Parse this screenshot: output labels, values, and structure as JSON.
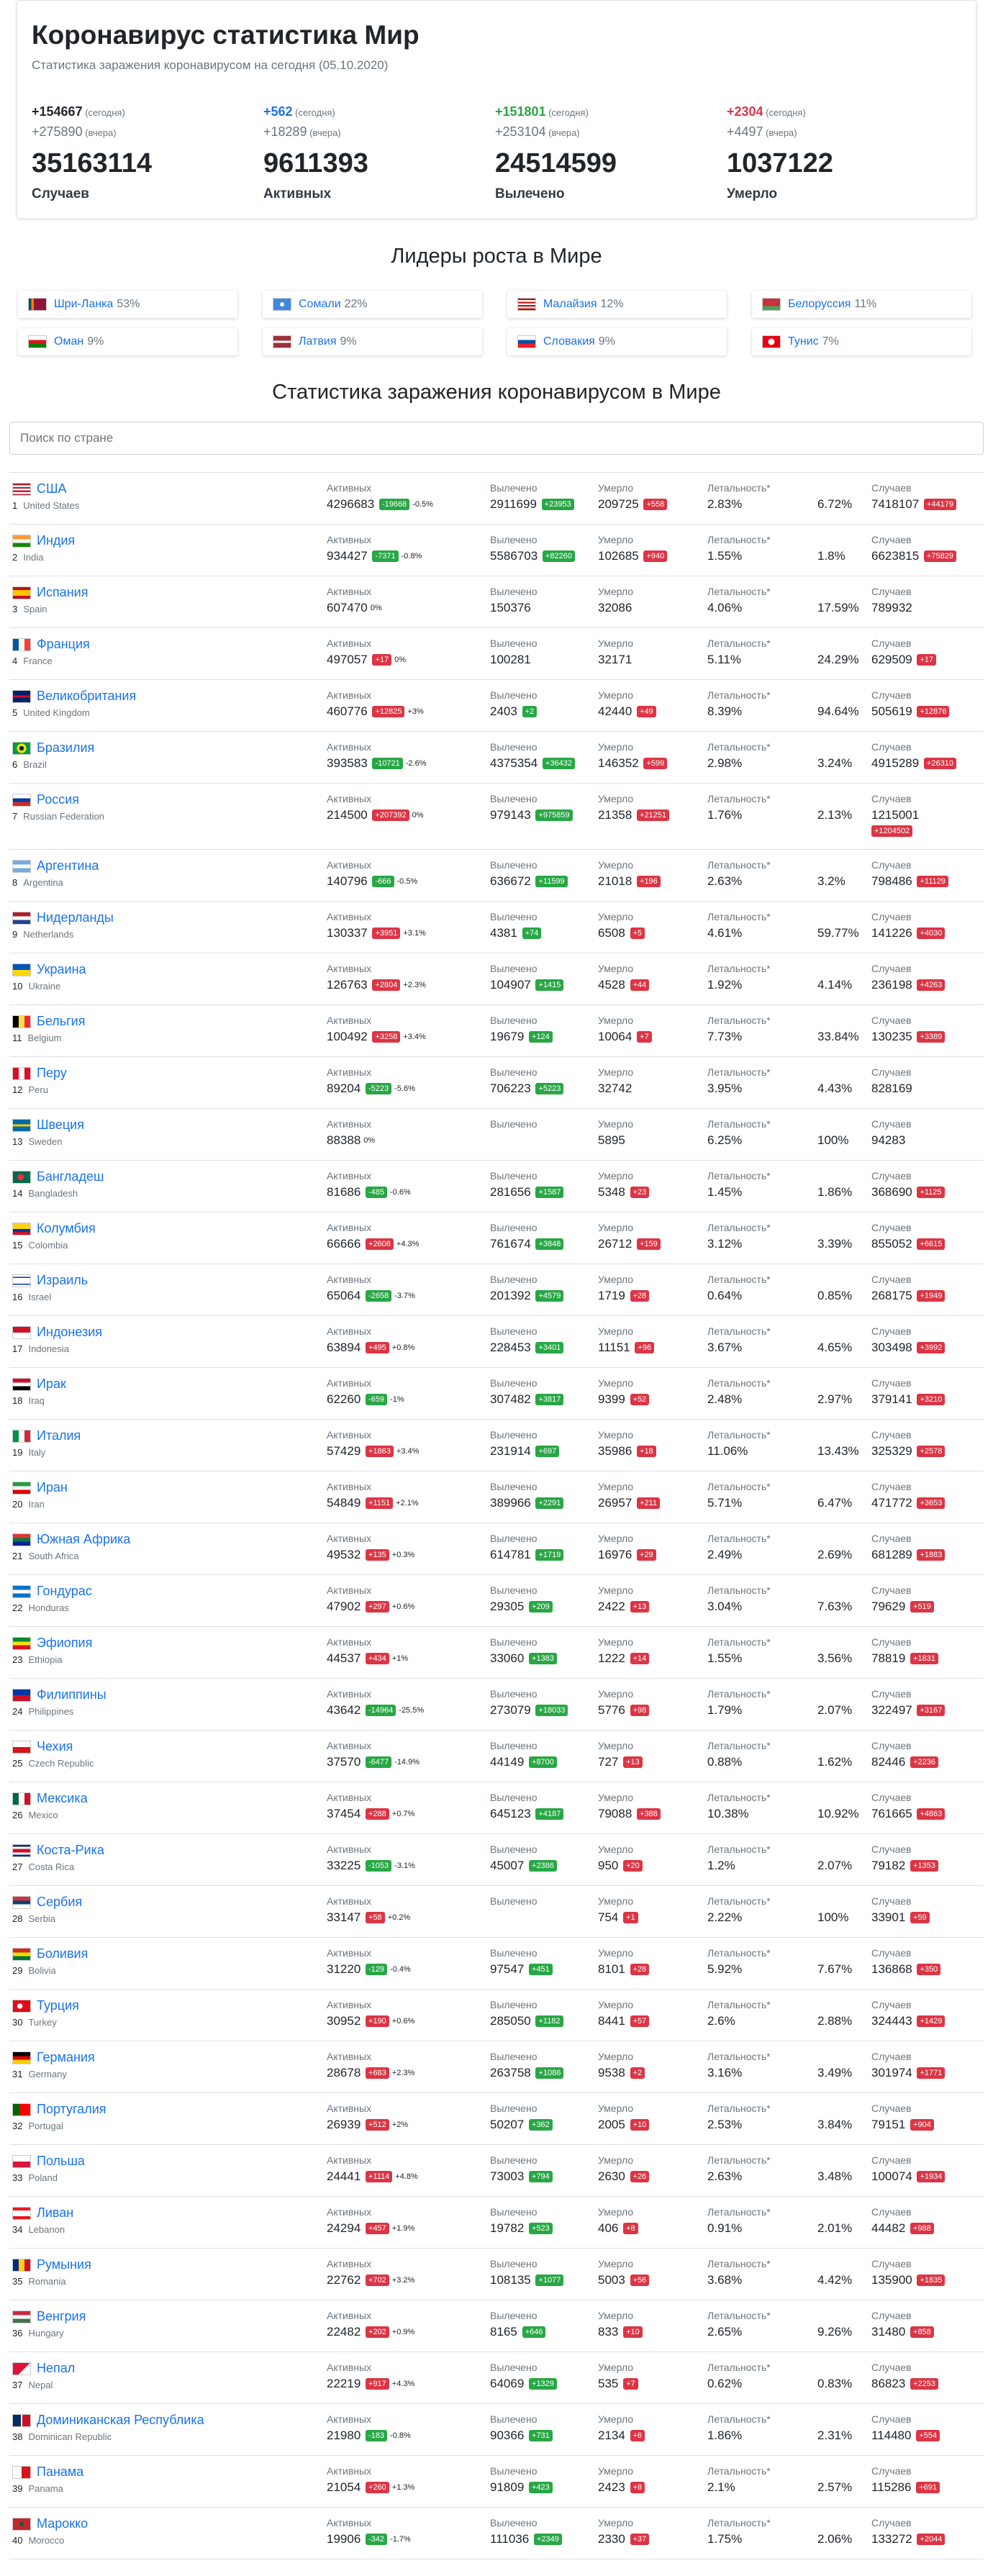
{
  "header": {
    "title": "Коронавирус статистика Мир",
    "subtitle": "Статистика заражения коронавирусом на сегодня (05.10.2020)"
  },
  "summary": [
    {
      "today": "+154667",
      "today_label": "(сегодня)",
      "yesterday": "+275890",
      "yesterday_label": "(вчера)",
      "total": "35163114",
      "name": "Случаев",
      "color": "dark"
    },
    {
      "today": "+562",
      "today_label": "(сегодня)",
      "yesterday": "+18289",
      "yesterday_label": "(вчера)",
      "total": "9611393",
      "name": "Активных",
      "color": "blue"
    },
    {
      "today": "+151801",
      "today_label": "(сегодня)",
      "yesterday": "+253104",
      "yesterday_label": "(вчера)",
      "total": "24514599",
      "name": "Вылечено",
      "color": "green"
    },
    {
      "today": "+2304",
      "today_label": "(сегодня)",
      "yesterday": "+4497",
      "yesterday_label": "(вчера)",
      "total": "1037122",
      "name": "Умерло",
      "color": "red"
    }
  ],
  "leaders": {
    "title": "Лидеры роста в Мире",
    "items": [
      {
        "name": "Шри-Ланка",
        "pct": "53%",
        "flag": "lk"
      },
      {
        "name": "Сомали",
        "pct": "22%",
        "flag": "so"
      },
      {
        "name": "Малайзия",
        "pct": "12%",
        "flag": "my"
      },
      {
        "name": "Белоруссия",
        "pct": "11%",
        "flag": "by"
      },
      {
        "name": "Оман",
        "pct": "9%",
        "flag": "om"
      },
      {
        "name": "Латвия",
        "pct": "9%",
        "flag": "lv"
      },
      {
        "name": "Словакия",
        "pct": "9%",
        "flag": "sk"
      },
      {
        "name": "Тунис",
        "pct": "7%",
        "flag": "tn"
      }
    ]
  },
  "stats": {
    "title": "Статистика заражения коронавирусом в Мире",
    "search_placeholder": "Поиск по стране",
    "labels": {
      "active": "Активных",
      "recovered": "Вылечено",
      "deaths": "Умерло",
      "lethality": "Летальность*",
      "cases": "Случаев"
    }
  },
  "countries": [
    {
      "rank": "1",
      "ru": "США",
      "en": "United States",
      "flag": "us",
      "active": "4296683",
      "active_delta": "-19668",
      "active_pct": "-0.5%",
      "rec": "2911699",
      "rec_delta": "+23953",
      "dead": "209725",
      "dead_delta": "+558",
      "let1": "2.83%",
      "let2": "6.72%",
      "cases": "7418107",
      "cases_delta": "+44179"
    },
    {
      "rank": "2",
      "ru": "Индия",
      "en": "India",
      "flag": "in",
      "active": "934427",
      "active_delta": "-7371",
      "active_pct": "-0.8%",
      "rec": "5586703",
      "rec_delta": "+82260",
      "dead": "102685",
      "dead_delta": "+940",
      "let1": "1.55%",
      "let2": "1.8%",
      "cases": "6623815",
      "cases_delta": "+75829"
    },
    {
      "rank": "3",
      "ru": "Испания",
      "en": "Spain",
      "flag": "es",
      "active": "607470",
      "active_delta": "",
      "active_pct": "0%",
      "rec": "150376",
      "rec_delta": "",
      "dead": "32086",
      "dead_delta": "",
      "let1": "4.06%",
      "let2": "17.59%",
      "cases": "789932",
      "cases_delta": ""
    },
    {
      "rank": "4",
      "ru": "Франция",
      "en": "France",
      "flag": "fr",
      "active": "497057",
      "active_delta": "+17",
      "active_pct": "0%",
      "rec": "100281",
      "rec_delta": "",
      "dead": "32171",
      "dead_delta": "",
      "let1": "5.11%",
      "let2": "24.29%",
      "cases": "629509",
      "cases_delta": "+17"
    },
    {
      "rank": "5",
      "ru": "Великобритания",
      "en": "United Kingdom",
      "flag": "gb",
      "active": "460776",
      "active_delta": "+12825",
      "active_pct": "+3%",
      "rec": "2403",
      "rec_delta": "+2",
      "dead": "42440",
      "dead_delta": "+49",
      "let1": "8.39%",
      "let2": "94.64%",
      "cases": "505619",
      "cases_delta": "+12876"
    },
    {
      "rank": "6",
      "ru": "Бразилия",
      "en": "Brazil",
      "flag": "br",
      "active": "393583",
      "active_delta": "-10721",
      "active_pct": "-2.6%",
      "rec": "4375354",
      "rec_delta": "+36432",
      "dead": "146352",
      "dead_delta": "+599",
      "let1": "2.98%",
      "let2": "3.24%",
      "cases": "4915289",
      "cases_delta": "+26310"
    },
    {
      "rank": "7",
      "ru": "Россия",
      "en": "Russian Federation",
      "flag": "ru",
      "active": "214500",
      "active_delta": "+207392",
      "active_pct": "0%",
      "rec": "979143",
      "rec_delta": "+975859",
      "dead": "21358",
      "dead_delta": "+21251",
      "let1": "1.76%",
      "let2": "2.13%",
      "cases": "1215001",
      "cases_delta": "+1204502",
      "tall": true
    },
    {
      "rank": "8",
      "ru": "Аргентина",
      "en": "Argentina",
      "flag": "ar",
      "active": "140796",
      "active_delta": "-666",
      "active_pct": "-0.5%",
      "rec": "636672",
      "rec_delta": "+11599",
      "dead": "21018",
      "dead_delta": "+196",
      "let1": "2.63%",
      "let2": "3.2%",
      "cases": "798486",
      "cases_delta": "+11129"
    },
    {
      "rank": "9",
      "ru": "Нидерланды",
      "en": "Netherlands",
      "flag": "nl",
      "active": "130337",
      "active_delta": "+3951",
      "active_pct": "+3.1%",
      "rec": "4381",
      "rec_delta": "+74",
      "dead": "6508",
      "dead_delta": "+5",
      "let1": "4.61%",
      "let2": "59.77%",
      "cases": "141226",
      "cases_delta": "+4030"
    },
    {
      "rank": "10",
      "ru": "Украина",
      "en": "Ukraine",
      "flag": "ua",
      "active": "126763",
      "active_delta": "+2804",
      "active_pct": "+2.3%",
      "rec": "104907",
      "rec_delta": "+1415",
      "dead": "4528",
      "dead_delta": "+44",
      "let1": "1.92%",
      "let2": "4.14%",
      "cases": "236198",
      "cases_delta": "+4263"
    },
    {
      "rank": "11",
      "ru": "Бельгия",
      "en": "Belgium",
      "flag": "be",
      "active": "100492",
      "active_delta": "+3258",
      "active_pct": "+3.4%",
      "rec": "19679",
      "rec_delta": "+124",
      "dead": "10064",
      "dead_delta": "+7",
      "let1": "7.73%",
      "let2": "33.84%",
      "cases": "130235",
      "cases_delta": "+3389"
    },
    {
      "rank": "12",
      "ru": "Перу",
      "en": "Peru",
      "flag": "pe",
      "active": "89204",
      "active_delta": "-5223",
      "active_pct": "-5.6%",
      "rec": "706223",
      "rec_delta": "+5223",
      "dead": "32742",
      "dead_delta": "",
      "let1": "3.95%",
      "let2": "4.43%",
      "cases": "828169",
      "cases_delta": ""
    },
    {
      "rank": "13",
      "ru": "Швеция",
      "en": "Sweden",
      "flag": "se",
      "active": "88388",
      "active_delta": "",
      "active_pct": "0%",
      "rec": "",
      "rec_delta": "",
      "dead": "5895",
      "dead_delta": "",
      "let1": "6.25%",
      "let2": "100%",
      "cases": "94283",
      "cases_delta": ""
    },
    {
      "rank": "14",
      "ru": "Бангладеш",
      "en": "Bangladesh",
      "flag": "bd",
      "active": "81686",
      "active_delta": "-485",
      "active_pct": "-0.6%",
      "rec": "281656",
      "rec_delta": "+1587",
      "dead": "5348",
      "dead_delta": "+23",
      "let1": "1.45%",
      "let2": "1.86%",
      "cases": "368690",
      "cases_delta": "+1125"
    },
    {
      "rank": "15",
      "ru": "Колумбия",
      "en": "Colombia",
      "flag": "co",
      "active": "66666",
      "active_delta": "+2608",
      "active_pct": "+4.3%",
      "rec": "761674",
      "rec_delta": "+3848",
      "dead": "26712",
      "dead_delta": "+159",
      "let1": "3.12%",
      "let2": "3.39%",
      "cases": "855052",
      "cases_delta": "+6615"
    },
    {
      "rank": "16",
      "ru": "Израиль",
      "en": "Israel",
      "flag": "il",
      "active": "65064",
      "active_delta": "-2658",
      "active_pct": "-3.7%",
      "rec": "201392",
      "rec_delta": "+4579",
      "dead": "1719",
      "dead_delta": "+28",
      "let1": "0.64%",
      "let2": "0.85%",
      "cases": "268175",
      "cases_delta": "+1949"
    },
    {
      "rank": "17",
      "ru": "Индонезия",
      "en": "Indonesia",
      "flag": "id",
      "active": "63894",
      "active_delta": "+495",
      "active_pct": "+0.8%",
      "rec": "228453",
      "rec_delta": "+3401",
      "dead": "11151",
      "dead_delta": "+96",
      "let1": "3.67%",
      "let2": "4.65%",
      "cases": "303498",
      "cases_delta": "+3992"
    },
    {
      "rank": "18",
      "ru": "Ирак",
      "en": "Iraq",
      "flag": "iq",
      "active": "62260",
      "active_delta": "-659",
      "active_pct": "-1%",
      "rec": "307482",
      "rec_delta": "+3817",
      "dead": "9399",
      "dead_delta": "+52",
      "let1": "2.48%",
      "let2": "2.97%",
      "cases": "379141",
      "cases_delta": "+3210"
    },
    {
      "rank": "19",
      "ru": "Италия",
      "en": "Italy",
      "flag": "it",
      "active": "57429",
      "active_delta": "+1863",
      "active_pct": "+3.4%",
      "rec": "231914",
      "rec_delta": "+697",
      "dead": "35986",
      "dead_delta": "+18",
      "let1": "11.06%",
      "let2": "13.43%",
      "cases": "325329",
      "cases_delta": "+2578"
    },
    {
      "rank": "20",
      "ru": "Иран",
      "en": "Iran",
      "flag": "ir",
      "active": "54849",
      "active_delta": "+1151",
      "active_pct": "+2.1%",
      "rec": "389966",
      "rec_delta": "+2291",
      "dead": "26957",
      "dead_delta": "+211",
      "let1": "5.71%",
      "let2": "6.47%",
      "cases": "471772",
      "cases_delta": "+3653"
    },
    {
      "rank": "21",
      "ru": "Южная Африка",
      "en": "South Africa",
      "flag": "za",
      "active": "49532",
      "active_delta": "+135",
      "active_pct": "+0.3%",
      "rec": "614781",
      "rec_delta": "+1719",
      "dead": "16976",
      "dead_delta": "+29",
      "let1": "2.49%",
      "let2": "2.69%",
      "cases": "681289",
      "cases_delta": "+1883"
    },
    {
      "rank": "22",
      "ru": "Гондурас",
      "en": "Honduras",
      "flag": "hn",
      "active": "47902",
      "active_delta": "+297",
      "active_pct": "+0.6%",
      "rec": "29305",
      "rec_delta": "+209",
      "dead": "2422",
      "dead_delta": "+13",
      "let1": "3.04%",
      "let2": "7.63%",
      "cases": "79629",
      "cases_delta": "+519"
    },
    {
      "rank": "23",
      "ru": "Эфиопия",
      "en": "Ethiopia",
      "flag": "et",
      "active": "44537",
      "active_delta": "+434",
      "active_pct": "+1%",
      "rec": "33060",
      "rec_delta": "+1383",
      "dead": "1222",
      "dead_delta": "+14",
      "let1": "1.55%",
      "let2": "3.56%",
      "cases": "78819",
      "cases_delta": "+1831"
    },
    {
      "rank": "24",
      "ru": "Филиппины",
      "en": "Philippines",
      "flag": "ph",
      "active": "43642",
      "active_delta": "-14964",
      "active_pct": "-25.5%",
      "rec": "273079",
      "rec_delta": "+18033",
      "dead": "5776",
      "dead_delta": "+98",
      "let1": "1.79%",
      "let2": "2.07%",
      "cases": "322497",
      "cases_delta": "+3167"
    },
    {
      "rank": "25",
      "ru": "Чехия",
      "en": "Czech Republic",
      "flag": "cz",
      "active": "37570",
      "active_delta": "-6477",
      "active_pct": "-14.9%",
      "rec": "44149",
      "rec_delta": "+8700",
      "dead": "727",
      "dead_delta": "+13",
      "let1": "0.88%",
      "let2": "1.62%",
      "cases": "82446",
      "cases_delta": "+2236"
    },
    {
      "rank": "26",
      "ru": "Мексика",
      "en": "Mexico",
      "flag": "mx",
      "active": "37454",
      "active_delta": "+288",
      "active_pct": "+0.7%",
      "rec": "645123",
      "rec_delta": "+4187",
      "dead": "79088",
      "dead_delta": "+388",
      "let1": "10.38%",
      "let2": "10.92%",
      "cases": "761665",
      "cases_delta": "+4863"
    },
    {
      "rank": "27",
      "ru": "Коста-Рика",
      "en": "Costa Rica",
      "flag": "cr",
      "active": "33225",
      "active_delta": "-1053",
      "active_pct": "-3.1%",
      "rec": "45007",
      "rec_delta": "+2386",
      "dead": "950",
      "dead_delta": "+20",
      "let1": "1.2%",
      "let2": "2.07%",
      "cases": "79182",
      "cases_delta": "+1353"
    },
    {
      "rank": "28",
      "ru": "Сербия",
      "en": "Serbia",
      "flag": "rs",
      "active": "33147",
      "active_delta": "+58",
      "active_pct": "+0.2%",
      "rec": "",
      "rec_delta": "",
      "dead": "754",
      "dead_delta": "+1",
      "let1": "2.22%",
      "let2": "100%",
      "cases": "33901",
      "cases_delta": "+59"
    },
    {
      "rank": "29",
      "ru": "Боливия",
      "en": "Bolivia",
      "flag": "bo",
      "active": "31220",
      "active_delta": "-129",
      "active_pct": "-0.4%",
      "rec": "97547",
      "rec_delta": "+451",
      "dead": "8101",
      "dead_delta": "+28",
      "let1": "5.92%",
      "let2": "7.67%",
      "cases": "136868",
      "cases_delta": "+350"
    },
    {
      "rank": "30",
      "ru": "Турция",
      "en": "Turkey",
      "flag": "tr",
      "active": "30952",
      "active_delta": "+190",
      "active_pct": "+0.6%",
      "rec": "285050",
      "rec_delta": "+1182",
      "dead": "8441",
      "dead_delta": "+57",
      "let1": "2.6%",
      "let2": "2.88%",
      "cases": "324443",
      "cases_delta": "+1429"
    },
    {
      "rank": "31",
      "ru": "Германия",
      "en": "Germany",
      "flag": "de",
      "active": "28678",
      "active_delta": "+683",
      "active_pct": "+2.3%",
      "rec": "263758",
      "rec_delta": "+1086",
      "dead": "9538",
      "dead_delta": "+2",
      "let1": "3.16%",
      "let2": "3.49%",
      "cases": "301974",
      "cases_delta": "+1771"
    },
    {
      "rank": "32",
      "ru": "Португалия",
      "en": "Portugal",
      "flag": "pt",
      "active": "26939",
      "active_delta": "+512",
      "active_pct": "+2%",
      "rec": "50207",
      "rec_delta": "+362",
      "dead": "2005",
      "dead_delta": "+10",
      "let1": "2.53%",
      "let2": "3.84%",
      "cases": "79151",
      "cases_delta": "+904"
    },
    {
      "rank": "33",
      "ru": "Польша",
      "en": "Poland",
      "flag": "pl",
      "active": "24441",
      "active_delta": "+1114",
      "active_pct": "+4.8%",
      "rec": "73003",
      "rec_delta": "+794",
      "dead": "2630",
      "dead_delta": "+26",
      "let1": "2.63%",
      "let2": "3.48%",
      "cases": "100074",
      "cases_delta": "+1934"
    },
    {
      "rank": "34",
      "ru": "Ливан",
      "en": "Lebanon",
      "flag": "lb",
      "active": "24294",
      "active_delta": "+457",
      "active_pct": "+1.9%",
      "rec": "19782",
      "rec_delta": "+523",
      "dead": "406",
      "dead_delta": "+8",
      "let1": "0.91%",
      "let2": "2.01%",
      "cases": "44482",
      "cases_delta": "+988"
    },
    {
      "rank": "35",
      "ru": "Румыния",
      "en": "Romania",
      "flag": "ro",
      "active": "22762",
      "active_delta": "+702",
      "active_pct": "+3.2%",
      "rec": "108135",
      "rec_delta": "+1077",
      "dead": "5003",
      "dead_delta": "+56",
      "let1": "3.68%",
      "let2": "4.42%",
      "cases": "135900",
      "cases_delta": "+1835"
    },
    {
      "rank": "36",
      "ru": "Венгрия",
      "en": "Hungary",
      "flag": "hu",
      "active": "22482",
      "active_delta": "+202",
      "active_pct": "+0.9%",
      "rec": "8165",
      "rec_delta": "+646",
      "dead": "833",
      "dead_delta": "+10",
      "let1": "2.65%",
      "let2": "9.26%",
      "cases": "31480",
      "cases_delta": "+858"
    },
    {
      "rank": "37",
      "ru": "Непал",
      "en": "Nepal",
      "flag": "np",
      "active": "22219",
      "active_delta": "+917",
      "active_pct": "+4.3%",
      "rec": "64069",
      "rec_delta": "+1329",
      "dead": "535",
      "dead_delta": "+7",
      "let1": "0.62%",
      "let2": "0.83%",
      "cases": "86823",
      "cases_delta": "+2253"
    },
    {
      "rank": "38",
      "ru": "Доминиканская Республика",
      "en": "Dominican Republic",
      "flag": "do",
      "active": "21980",
      "active_delta": "-183",
      "active_pct": "-0.8%",
      "rec": "90366",
      "rec_delta": "+731",
      "dead": "2134",
      "dead_delta": "+6",
      "let1": "1.86%",
      "let2": "2.31%",
      "cases": "114480",
      "cases_delta": "+554"
    },
    {
      "rank": "39",
      "ru": "Панама",
      "en": "Panama",
      "flag": "pa",
      "active": "21054",
      "active_delta": "+260",
      "active_pct": "+1.3%",
      "rec": "91809",
      "rec_delta": "+423",
      "dead": "2423",
      "dead_delta": "+8",
      "let1": "2.1%",
      "let2": "2.57%",
      "cases": "115286",
      "cases_delta": "+691"
    },
    {
      "rank": "40",
      "ru": "Марокко",
      "en": "Morocco",
      "flag": "ma",
      "active": "19906",
      "active_delta": "-342",
      "active_pct": "-1.7%",
      "rec": "111036",
      "rec_delta": "+2349",
      "dead": "2330",
      "dead_delta": "+37",
      "let1": "1.75%",
      "let2": "2.06%",
      "cases": "133272",
      "cases_delta": "+2044"
    }
  ]
}
